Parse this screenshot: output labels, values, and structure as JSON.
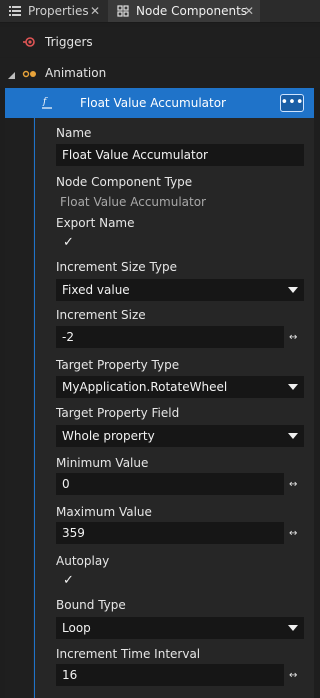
{
  "tabs": [
    {
      "label": "Properties",
      "icon": "list-icon"
    },
    {
      "label": "Node Components",
      "icon": "node-components-icon"
    }
  ],
  "tree": {
    "triggers": "Triggers",
    "animation": "Animation",
    "selected": "Float Value Accumulator"
  },
  "props": {
    "name_label": "Name",
    "name_value": "Float Value Accumulator",
    "type_label": "Node Component Type",
    "type_value": "Float Value Accumulator",
    "export_label": "Export Name",
    "export_checked": true,
    "inc_type_label": "Increment Size Type",
    "inc_type_value": "Fixed value",
    "inc_size_label": "Increment Size",
    "inc_size_value": "-2",
    "target_type_label": "Target Property Type",
    "target_type_value": "MyApplication.RotateWheel",
    "target_field_label": "Target Property Field",
    "target_field_value": "Whole property",
    "min_label": "Minimum Value",
    "min_value": "0",
    "max_label": "Maximum Value",
    "max_value": "359",
    "autoplay_label": "Autoplay",
    "autoplay_checked": true,
    "bound_label": "Bound Type",
    "bound_value": "Loop",
    "interval_label": "Increment Time Interval",
    "interval_value": "16"
  },
  "colors": {
    "accent": "#1f73c9",
    "background": "#1e1e1e",
    "field": "#161616"
  }
}
